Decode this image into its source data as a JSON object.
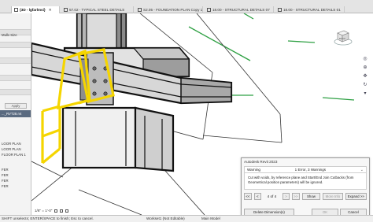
{
  "tabs": [
    {
      "label": "{3D - lgfarlmsi}",
      "active": true
    },
    {
      "label": "57.02 - TYPICAL STEEL DETAILS",
      "active": false
    },
    {
      "label": "S2.05 - FOUNDATION PLAN Copy 1",
      "active": false
    },
    {
      "label": "18.00 - STRUCTURAL DETAILS 07",
      "active": false
    },
    {
      "label": "18.00 - STRUCTURAL DETAILS 01",
      "active": false
    }
  ],
  "left_panel": {
    "items": [
      "Mullx Size",
      "Apply",
      "..._RVT28.rvt",
      "LOOR PLAN",
      "LOOR PLAN",
      "FLOOR PLAN 1",
      "FER",
      "FER",
      "FER",
      "FER"
    ]
  },
  "view_cube": {
    "label": "BACK"
  },
  "dialog": {
    "app_title": "Autodesk Revit 2023",
    "severity": "Warning",
    "summary": "1 Error, 3 Warnings",
    "message": "Cut with voids, by reference plane and Start/End Join Cutbacks (from Geometrical position parameters) will be ignored.",
    "page_indicator": "4 of 4",
    "buttons": {
      "first": "<<",
      "prev": "<",
      "next": ">",
      "last": ">>",
      "show": "Show",
      "more_info": "More Info",
      "expand": "Expand >>",
      "delete": "Delete Dimension(s)",
      "ok": "OK",
      "cancel": "Cancel"
    }
  },
  "view_control": {
    "scale": "1/8\" = 1'-0\""
  },
  "status_bar": {
    "prompt": "SHIFT unselects; ENTER/SPACE to finish; Esc to cancel.",
    "workset": "Workset1 (Not Editable)",
    "model": "Main Model"
  },
  "colors": {
    "highlight": "#f5d500",
    "steel": "#222222",
    "grid": "#2ea043"
  }
}
